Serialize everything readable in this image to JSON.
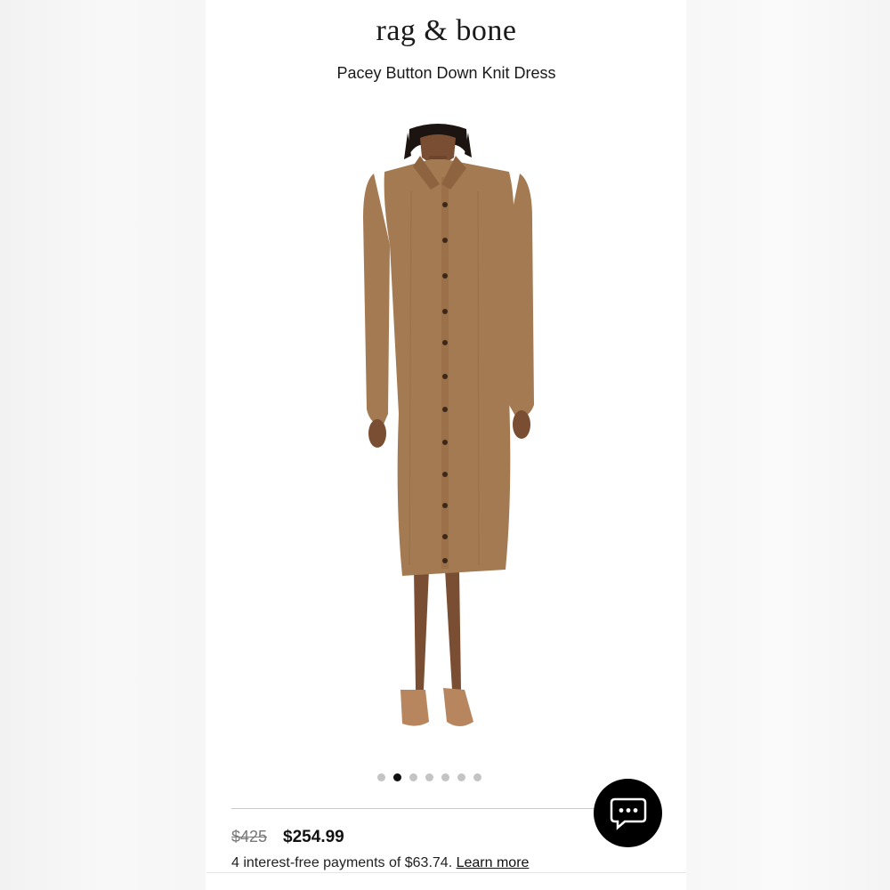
{
  "header": {
    "brand": "rag & bone",
    "product_title": "Pacey Button Down Knit Dress"
  },
  "gallery": {
    "image_subject": "model wearing camel button down knit dress",
    "dot_count": 7,
    "active_index": 1
  },
  "pricing": {
    "original_price": "$425",
    "sale_price": "$254.99",
    "installments_text": "4 interest-free payments of $63.74.",
    "learn_more_label": "Learn more"
  },
  "chat": {
    "icon": "chat-bubble-icon"
  },
  "colors": {
    "dress": "#a47a53",
    "active_dot": "#111111",
    "inactive_dot": "#c4c4c4",
    "chat_bg": "#000000"
  }
}
